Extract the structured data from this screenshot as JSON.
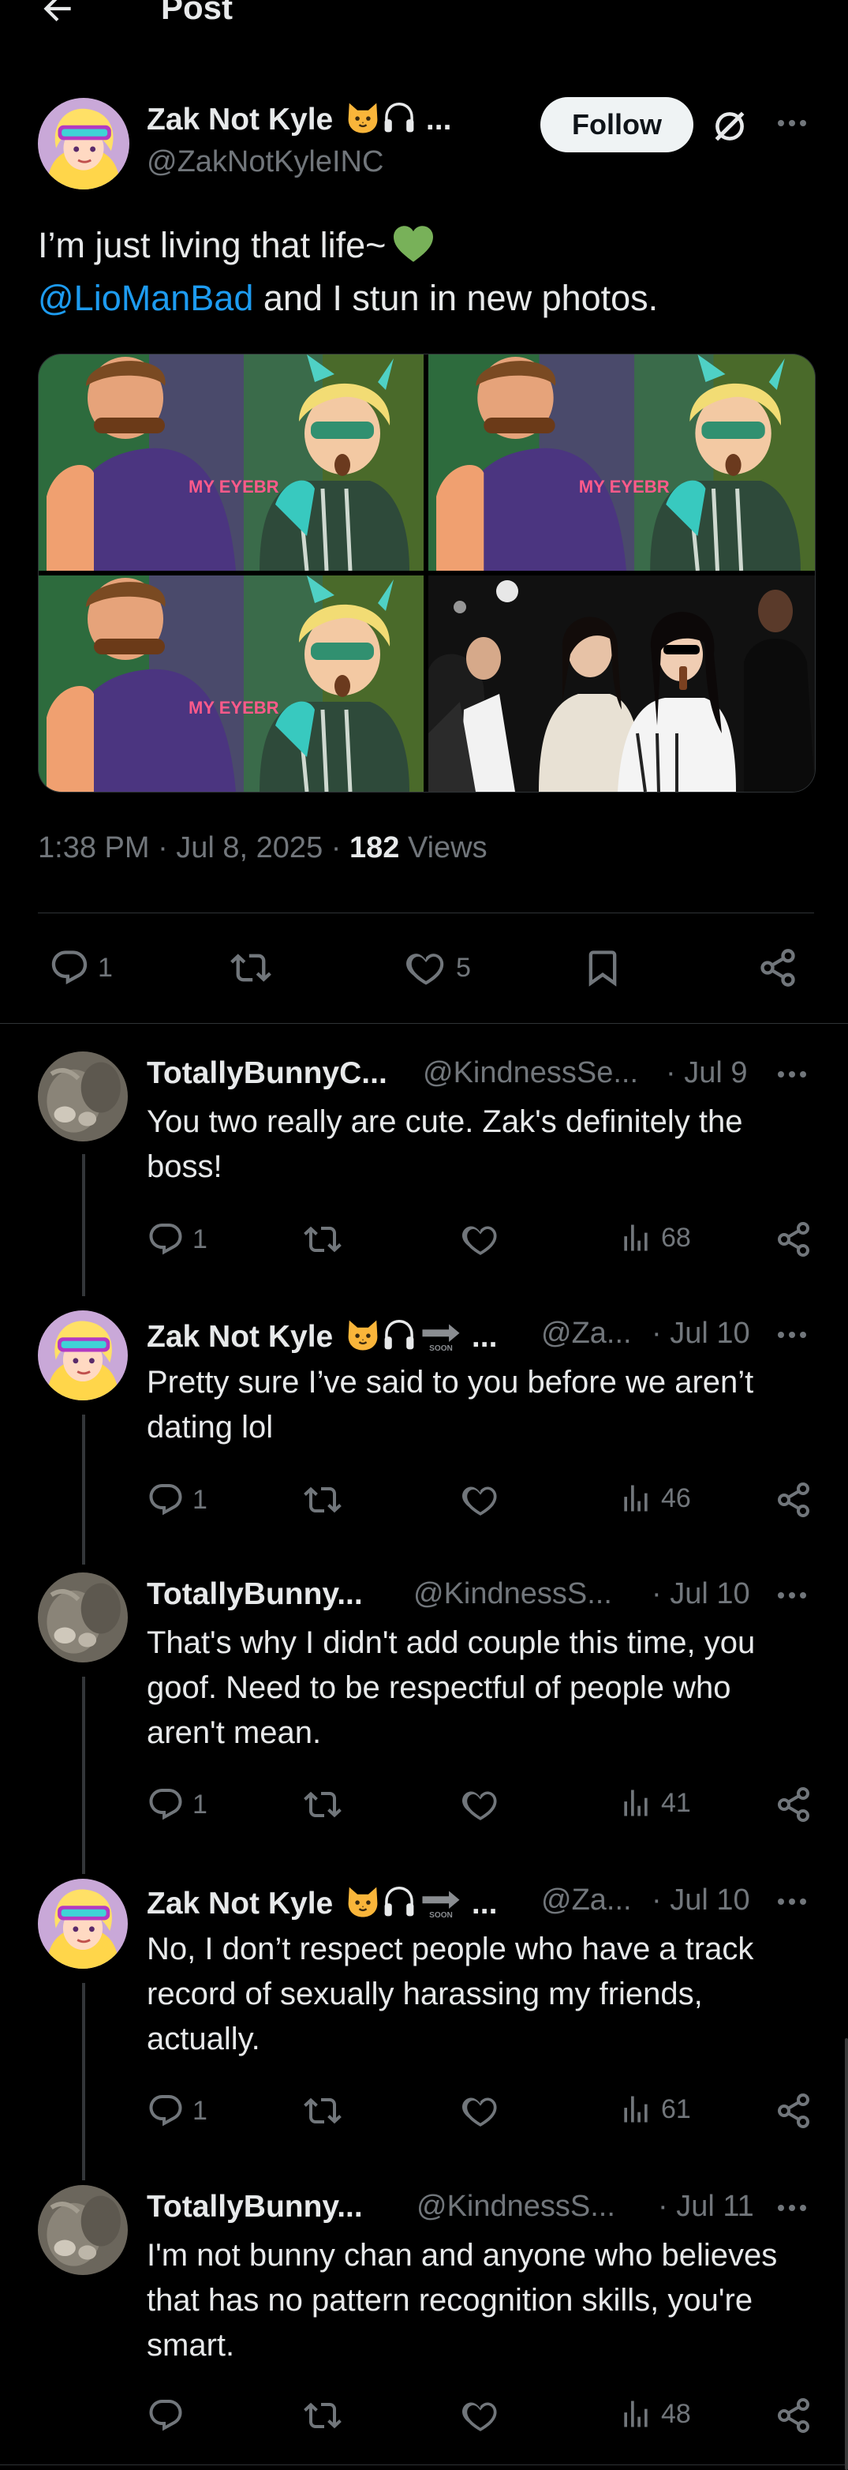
{
  "header": {
    "title": "Post"
  },
  "post": {
    "author_name": "Zak Not Kyle",
    "author_suffix": "...",
    "handle": "@ZakNotKyleINC",
    "follow_label": "Follow",
    "text_line1": "I’m just living that life~",
    "mention": "@LioManBad",
    "text_line2_rest": " and I stun in new photos.",
    "time": "1:38 PM · Jul 8, 2025 · ",
    "views_count": "182",
    "views_label": " Views",
    "replies": "1",
    "likes": "5",
    "media": [
      "cartoon-1",
      "cartoon-2",
      "cartoon-3",
      "photo-4"
    ]
  },
  "replies": [
    {
      "name": "TotallyBunnyC...",
      "handle": "@KindnessSe...",
      "date": "· Jul 9",
      "text": "You two really are cute. Zak's definitely the boss!",
      "replies": "1",
      "views": "68"
    },
    {
      "name": "Zak Not Kyle",
      "badge": "SOON",
      "ellipsis": "...",
      "handle": "@Za...",
      "date": "· Jul 10",
      "text": "Pretty sure I’ve said to you before we aren’t dating lol",
      "replies": "1",
      "views": "46"
    },
    {
      "name": "TotallyBunny...",
      "handle": "@KindnessS...",
      "date": "· Jul 10",
      "text": "That's why I didn't add couple this time, you goof. Need to be respectful of people who aren't mean.",
      "replies": "1",
      "views": "41"
    },
    {
      "name": "Zak Not Kyle",
      "badge": "SOON",
      "ellipsis": "...",
      "handle": "@Za...",
      "date": "· Jul 10",
      "text": "No, I don’t respect people who have a track record of sexually harassing my friends, actually.",
      "replies": "1",
      "views": "61"
    },
    {
      "name": "TotallyBunny...",
      "handle": "@KindnessS...",
      "date": "· Jul 11",
      "text": "I'm not bunny chan and anyone who believes that  has no pattern recognition skills, you're smart.",
      "replies": "",
      "views": "48"
    }
  ],
  "colors": {
    "background": "#000000",
    "link": "#1d9bf0",
    "muted": "#71767b",
    "like_heart_emoji": "#78b159"
  }
}
